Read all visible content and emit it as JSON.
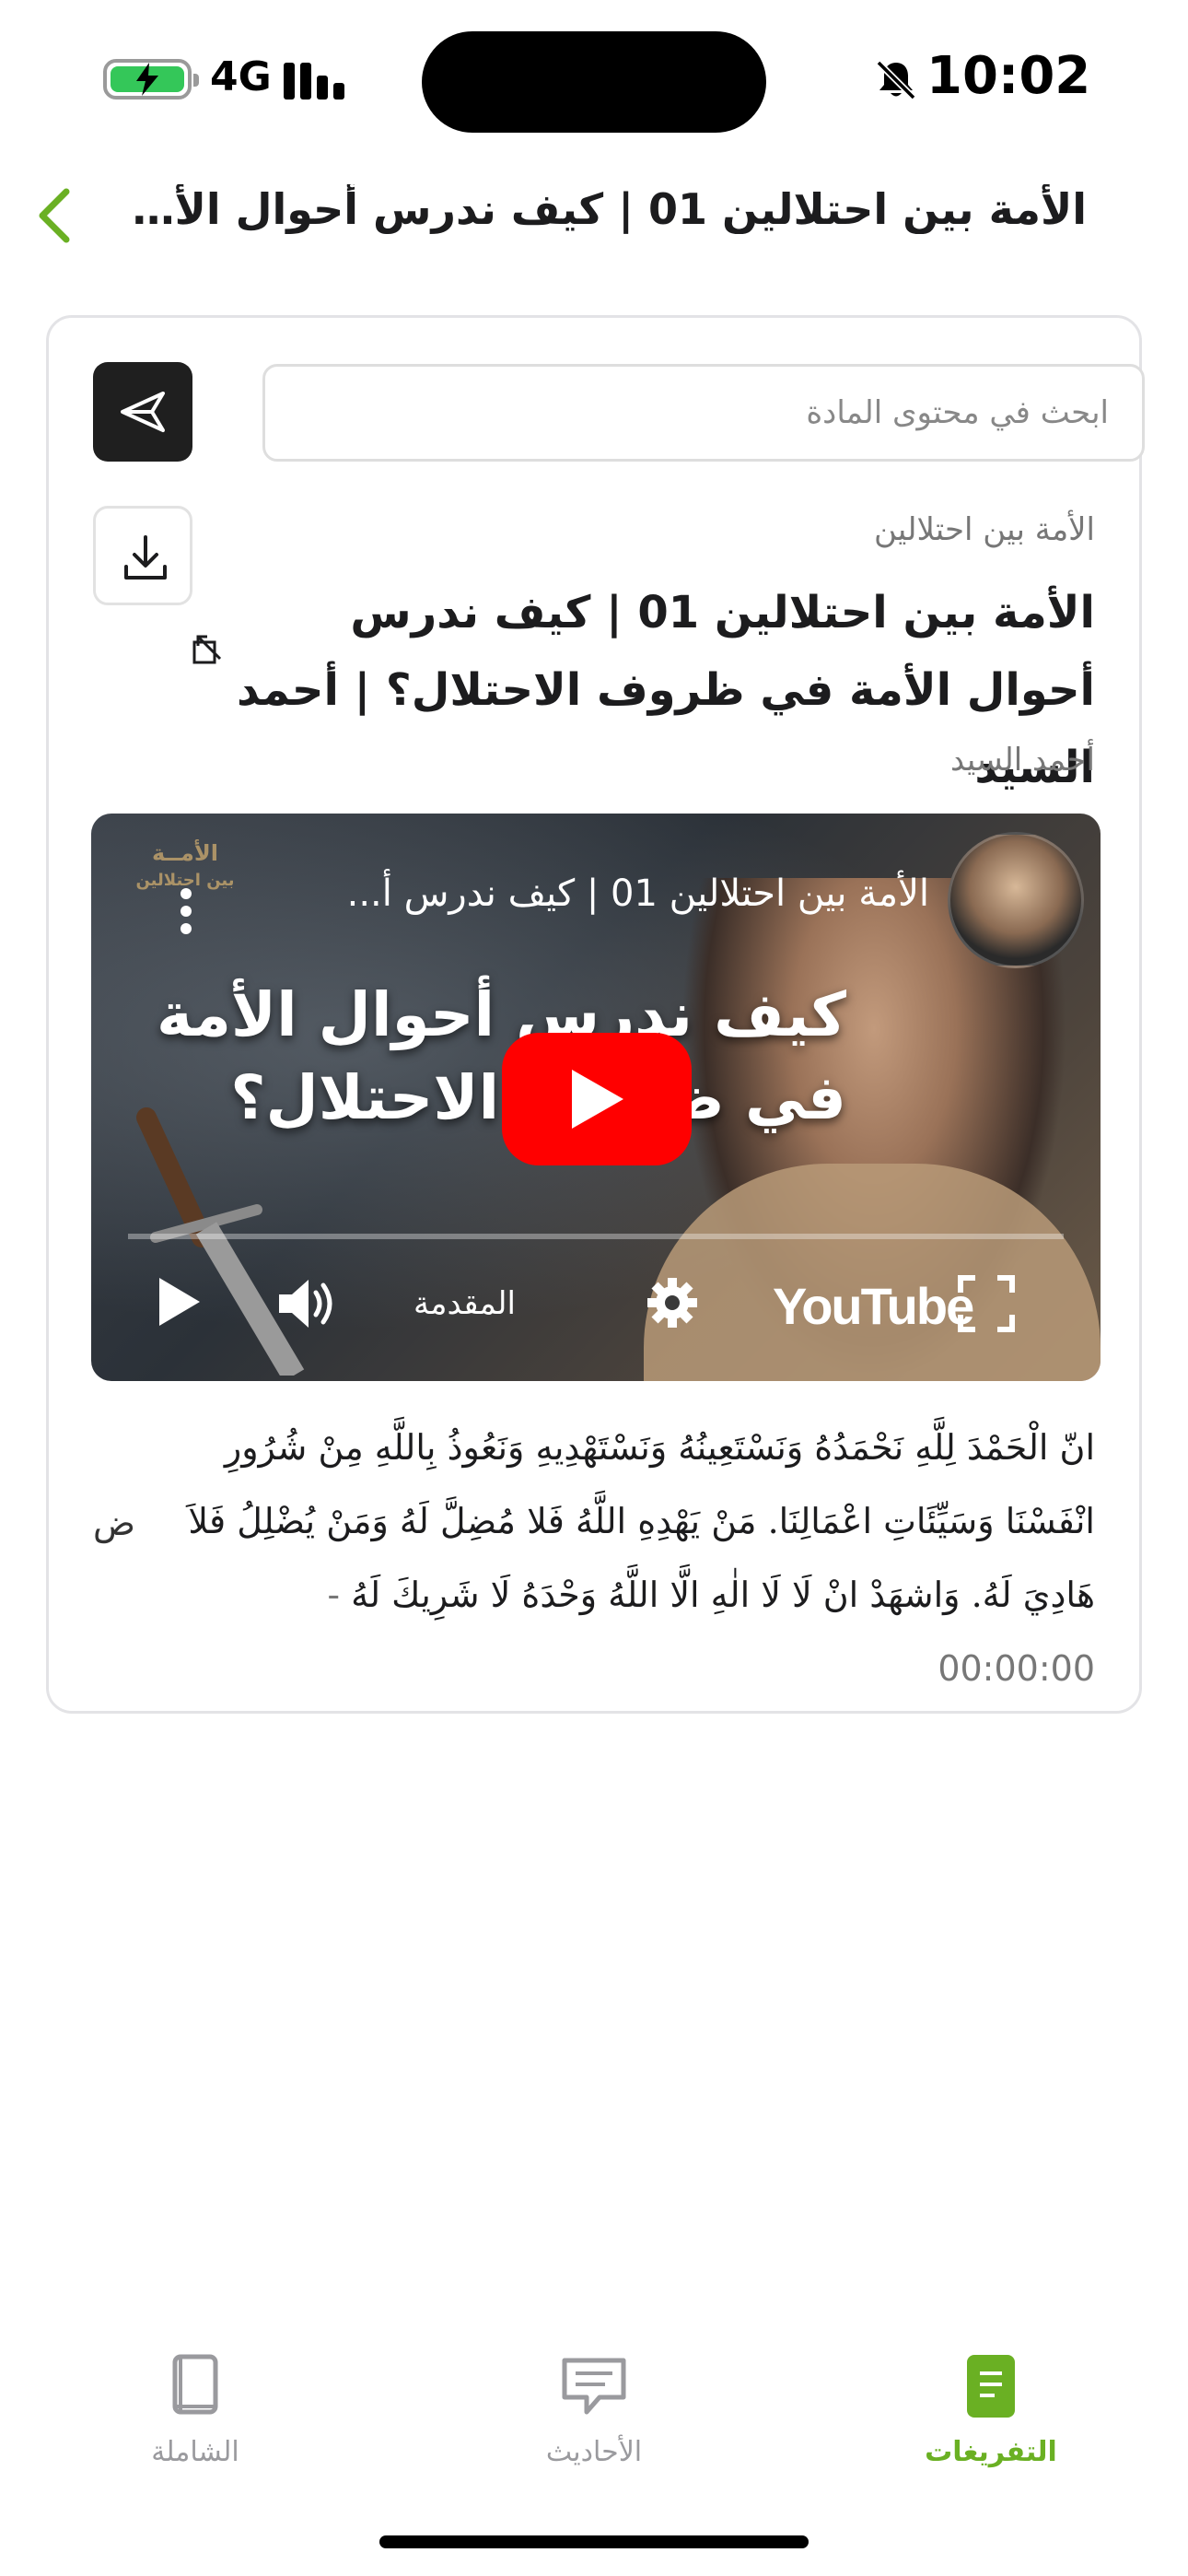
{
  "status_bar": {
    "network": "4G",
    "time": "10:02",
    "battery_color": "#34c759"
  },
  "header": {
    "title": "الأمة بين احتلالين 01 | كيف ندرس أحوال الأمة في...",
    "back_icon": "chevron-left-icon",
    "accent": "#6ab023"
  },
  "search": {
    "placeholder": "ابحث في محتوى المادة",
    "value": ""
  },
  "lesson": {
    "series": "الأمة بين احتلالين",
    "title": "الأمة بين احتلالين 01 | كيف ندرس أحوال الأمة في ظروف الاحتلال؟ | أحمد السيد",
    "author": "أحمد السيد"
  },
  "video": {
    "title": "الأمة بين احتلالين 01 | كيف ندرس أ...",
    "logo_line1": "الأمــة",
    "logo_line2": "بين احتلالين",
    "overlay_line1": "كيف ندرس أحوال الأمة",
    "overlay_line2": "في ظروف الاحتلال؟",
    "chapter": "المقدمة",
    "brand": "YouTube"
  },
  "transcript": {
    "text": "انّ الْحَمْدَ لِلَّهِ نَحْمَدُهُ وَنَسْتَعِينُهُ وَنَسْتَهْدِيهِ وَنَعُوذُ بِاللَّهِ مِنْ شُرُورِ انْفَسْنَا وَسَيِّئَاتِ اعْمَالِنَا. مَنْ يَهْدِهِ اللَّهُ فَلا مُضِلَّ لَهُ وَمَنْ يُضْلِلُ فَلاَ هَادِيَ لَهُ. وَاشهَدْ انْ لَا لَا الٰهِ الَّا اللَّهُ وَحْدَهُ لَا شَرِيكَ لَهُ",
    "timestamp": "- 00:00:00",
    "side_letter": "ض"
  },
  "tabs": [
    {
      "label": "الشاملة",
      "icon": "book-icon",
      "active": false
    },
    {
      "label": "الأحاديث",
      "icon": "chat-bubble-icon",
      "active": false
    },
    {
      "label": "التفريغات",
      "icon": "document-icon",
      "active": true
    }
  ]
}
